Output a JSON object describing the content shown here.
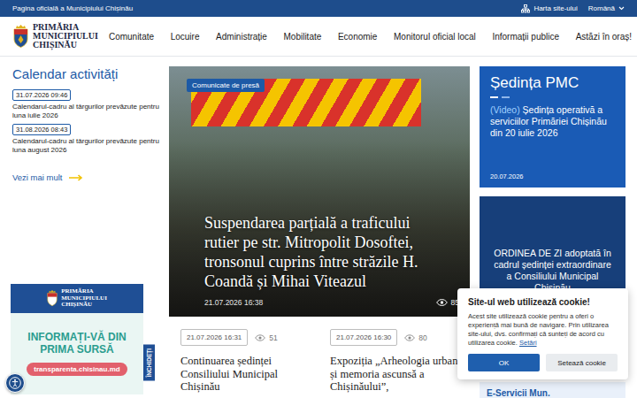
{
  "top_bar": {
    "official": "Pagina oficială a Municipiului Chișinău",
    "sitemap": "Harta site-ului",
    "language": "Română"
  },
  "logo": {
    "lines": [
      "PRIMĂRIA",
      "MUNICIPIULUI",
      "CHIȘINĂU"
    ]
  },
  "nav": [
    "Comunitate",
    "Locuire",
    "Administrație",
    "Mobilitate",
    "Economie",
    "Monitorul oficial local",
    "Informații publice",
    "Astăzi în oraș!"
  ],
  "calendar": {
    "title": "Calendar activități",
    "items": [
      {
        "date": "31.07.2026 09:46",
        "text": "Calendarul-cadru al târgurilor prevăzute pentru luna iulie 2026"
      },
      {
        "date": "31.08.2026 08:43",
        "text": "Calendarul-cadru al târgurilor prevăzute pentru luna august 2026"
      }
    ],
    "more": "Vezi mai mult"
  },
  "banner": {
    "logo_lines": [
      "PRIMĂRIA",
      "MUNICIPIULUI",
      "CHIȘINĂU"
    ],
    "headline_lines": [
      "INFORMAȚI-VĂ DIN",
      "PRIMA SURSĂ"
    ],
    "url": "transparenta.chisinau.md",
    "close": "ÎNCHIDEȚI"
  },
  "hero": {
    "tag": "Comunicate de presă",
    "title": "Suspendarea parțială a traficului rutier pe str. Mitropolit Dosoftei, tronsonul cuprins între străzile H. Coandă și Mihai Viteazul",
    "date": "21.07.2026 16:38",
    "views": "85"
  },
  "news": [
    {
      "date": "21.07.2026 16:31",
      "views": "51",
      "title": "Continuarea ședinței Consiliului Municipal Chișinău"
    },
    {
      "date": "21.07.2026 16:30",
      "views": "80",
      "title": "Expoziția „Arheologia urbană și memoria ascunsă a Chișinăului”,"
    }
  ],
  "sidebar": {
    "pmc": {
      "title": "Ședința PMC",
      "video_tag": "(Video)",
      "text": "Ședința operativă a serviciilor Primăriei Chișinău din 20 iulie 2026",
      "date": "20.07.2026"
    },
    "agenda": {
      "text": "ORDINEA DE ZI adoptată în cadrul ședinței extraordinare a Consiliului Municipal Chișinău"
    },
    "eservices": {
      "title": "E-Servicii Mun."
    }
  },
  "cookie": {
    "title": "Site-ul web utilizează cookie!",
    "text": "Acest site utilizează cookie pentru a oferi o experiență mai bună de navigare. Prin utilizarea site-ului, dvs. confirmați că sunteți de acord cu utilizarea cookie.",
    "link": "Setări",
    "ok": "OK",
    "settings": "Setează cookie"
  }
}
